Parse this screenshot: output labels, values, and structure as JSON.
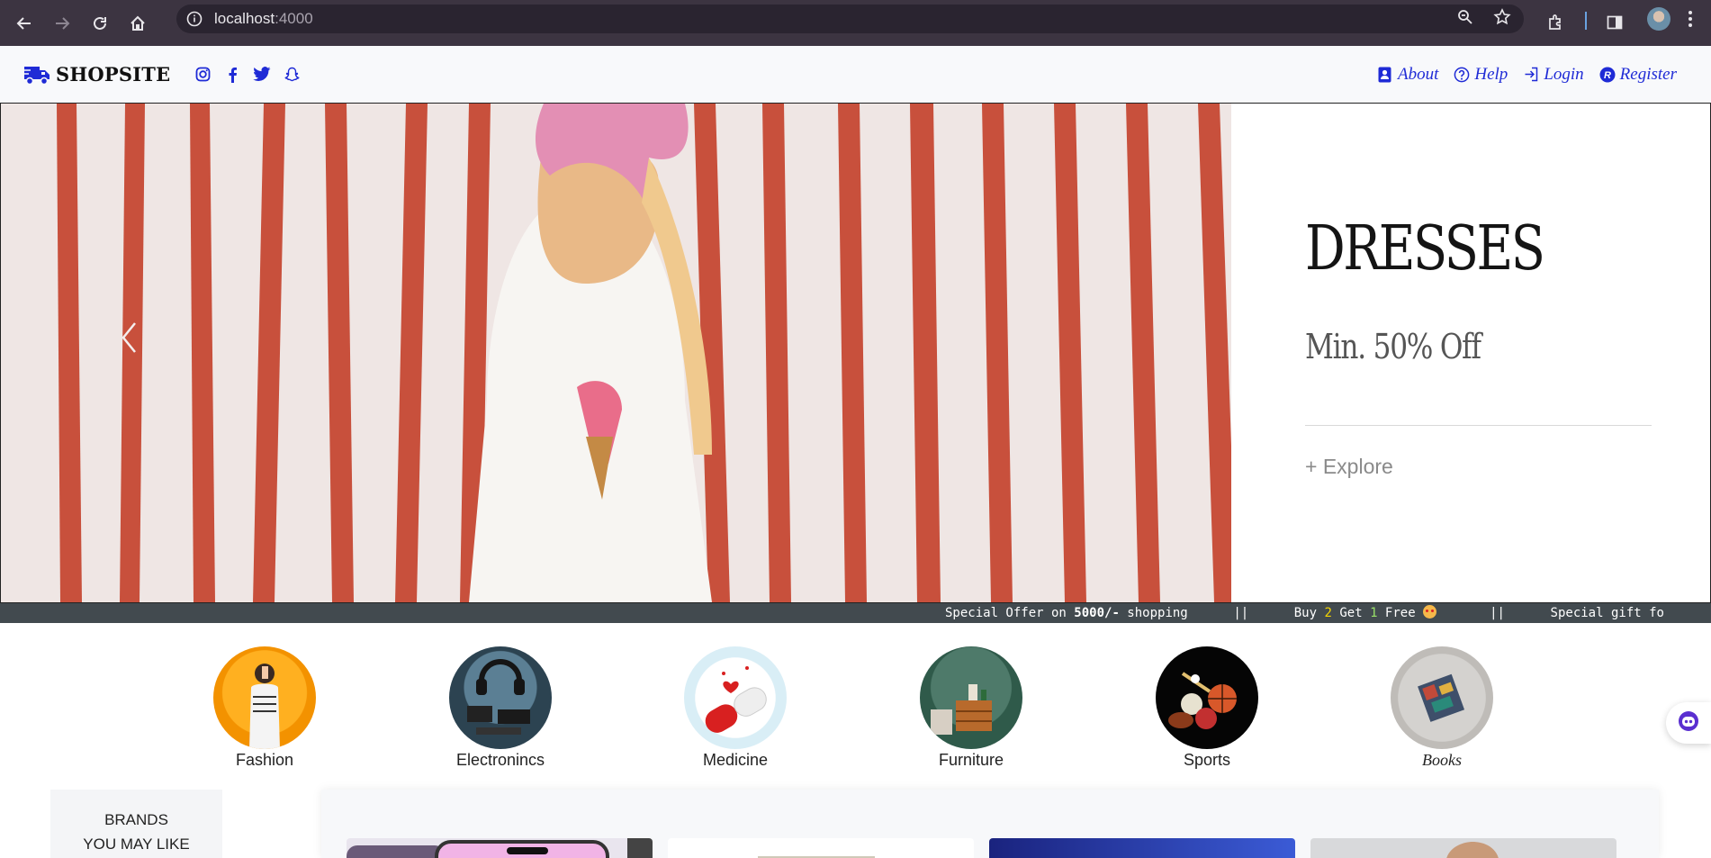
{
  "browser": {
    "url_host": "localhost",
    "url_port": ":4000"
  },
  "navbar": {
    "brand_name": "SHOPSITE",
    "links": {
      "about": "About",
      "help": "Help",
      "login": "Login",
      "register": "Register"
    }
  },
  "hero": {
    "title": "DRESSES",
    "subtitle": "Min. 50% Off",
    "cta": "+ Explore"
  },
  "ticker": {
    "offer1_a": "Special Offer on ",
    "offer1_b": "5000/-",
    "offer1_c": " shopping",
    "sep": "||",
    "offer2_a": "Buy ",
    "offer2_b": "2",
    "offer2_c": " Get ",
    "offer2_d": "1",
    "offer2_e": " Free ",
    "offer3": "Special gift fo"
  },
  "categories": [
    {
      "label": "Fashion"
    },
    {
      "label": "Electronincs"
    },
    {
      "label": "Medicine"
    },
    {
      "label": "Furniture"
    },
    {
      "label": "Sports"
    },
    {
      "label": "Books"
    }
  ],
  "brands": {
    "line1": "BRANDS",
    "line2": "YOU MAY LIKE"
  },
  "colors": {
    "link": "#1f2bd6",
    "chrome": "#3c3441",
    "ticker_bg": "#424a4f"
  }
}
